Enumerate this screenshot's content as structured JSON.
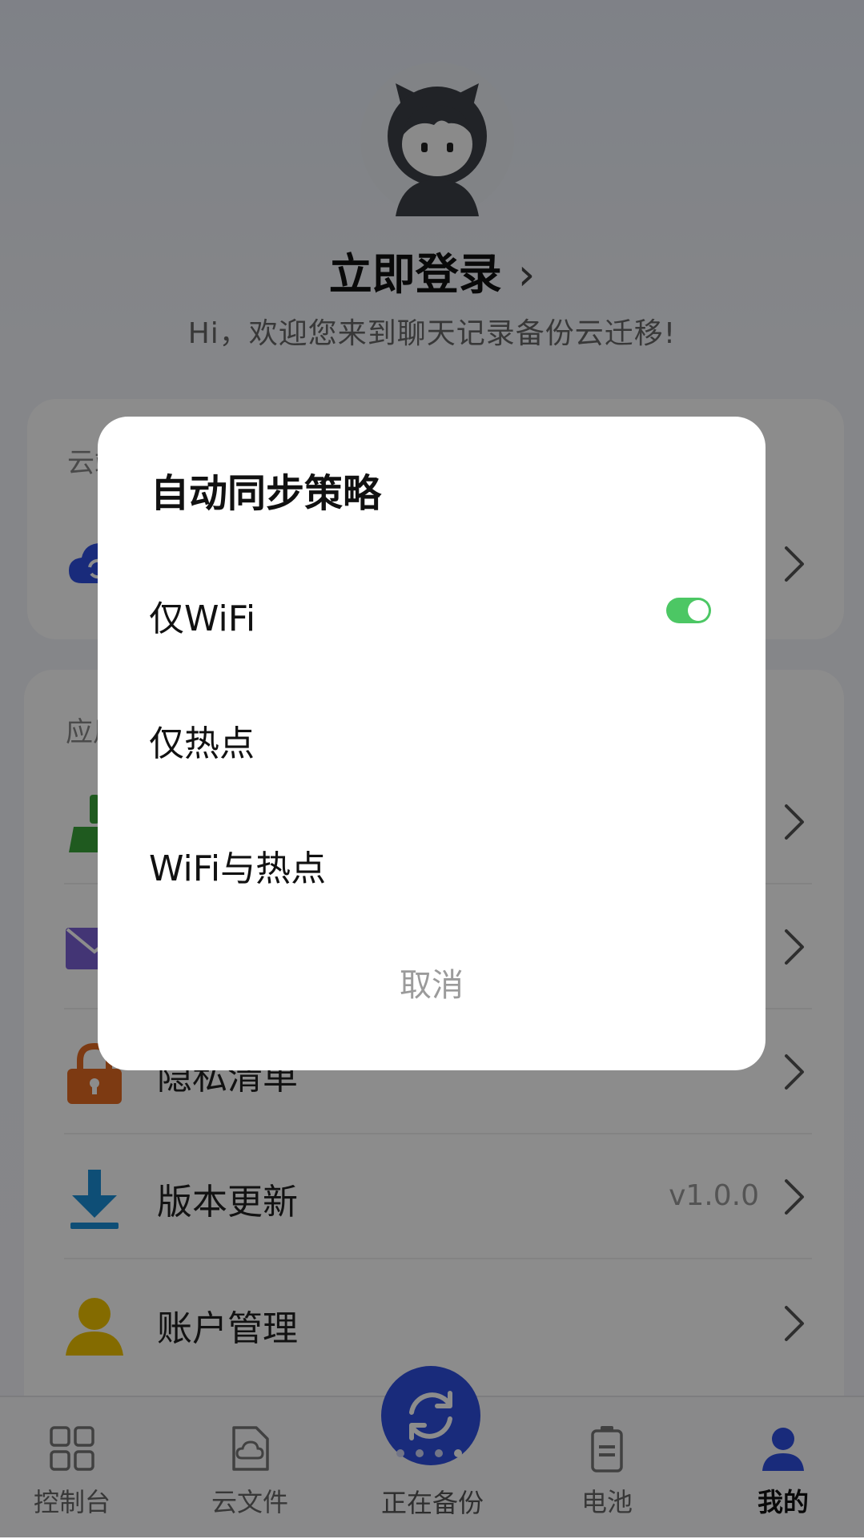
{
  "profile": {
    "login_title": "立即登录",
    "login_chevron": "›",
    "welcome": "Hi，欢迎您来到聊天记录备份云迁移!"
  },
  "cloud_card": {
    "section_label": "云端",
    "items": [
      {
        "icon": "cloud-sync-icon",
        "label": ""
      }
    ]
  },
  "app_card": {
    "section_label": "应用",
    "items": [
      {
        "icon": "broom-icon",
        "label": ""
      },
      {
        "icon": "mail-icon",
        "label": ""
      },
      {
        "icon": "lock-icon",
        "label": "隐私清单"
      },
      {
        "icon": "download-icon",
        "label": "版本更新",
        "value": "v1.0.0"
      },
      {
        "icon": "user-icon",
        "label": "账户管理"
      }
    ]
  },
  "bottom_nav": {
    "items": [
      {
        "label": "控制台",
        "icon": "grid-icon"
      },
      {
        "label": "云文件",
        "icon": "cloud-file-icon"
      },
      {
        "label": "正在备份",
        "icon": "sync-icon"
      },
      {
        "label": "电池",
        "icon": "battery-icon"
      },
      {
        "label": "我的",
        "icon": "person-icon"
      }
    ],
    "active_index": 4
  },
  "dialog": {
    "title": "自动同步策略",
    "options": [
      {
        "label": "仅WiFi",
        "selected": true
      },
      {
        "label": "仅热点",
        "selected": false
      },
      {
        "label": "WiFi与热点",
        "selected": false
      }
    ],
    "cancel_label": "取消"
  },
  "colors": {
    "accent_blue": "#2f4fe0",
    "toggle_green": "#4cc764",
    "lock_orange": "#e46a22",
    "download_blue": "#1a8fd8",
    "user_yellow": "#f0c400",
    "broom_green": "#3aa53a",
    "mail_purple": "#7b61d6"
  }
}
